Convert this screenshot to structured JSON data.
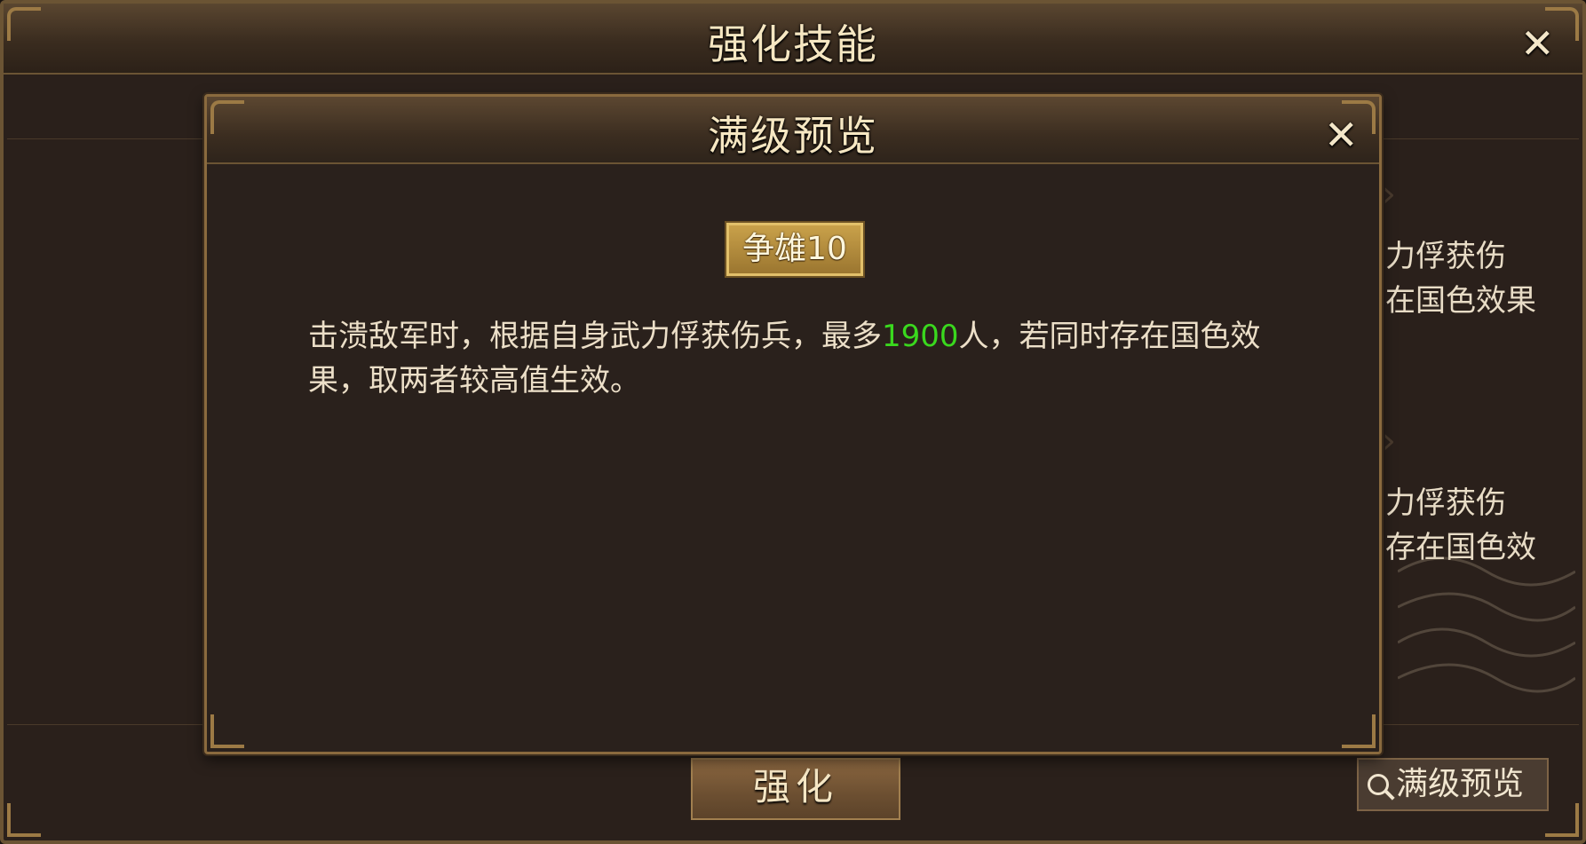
{
  "main": {
    "title": "强化技能",
    "background_skills": [
      {
        "line1": "力俘获伤",
        "line2": "在国色效果"
      },
      {
        "line1": "力俘获伤",
        "line2": "存在国色效"
      }
    ],
    "enhance_button": "强化",
    "preview_button": "满级预览"
  },
  "modal": {
    "title": "满级预览",
    "skill_name": "争雄10",
    "description": {
      "part1": "击溃敌军时，根据自身武力俘获伤兵，最多",
      "highlight": "1900",
      "part2": "人，若同时存在国色效果，取两者较高值生效。"
    }
  },
  "colors": {
    "highlight": "#3ad81e",
    "title_text": "#f6e7c2",
    "panel_bg": "#2a211c",
    "border_gold": "#8a6a3e"
  }
}
